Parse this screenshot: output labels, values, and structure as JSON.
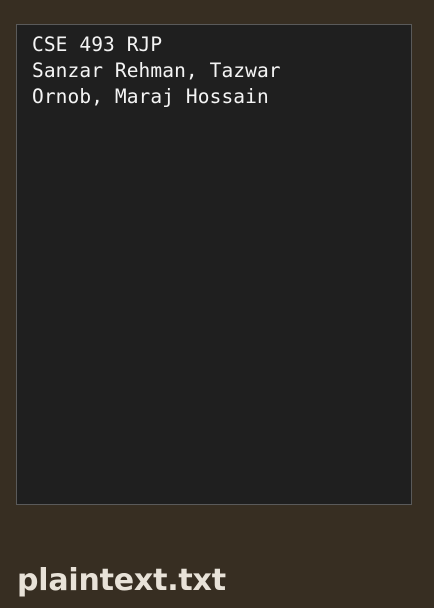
{
  "file_preview": {
    "text": "CSE 493 RJP\nSanzar Rehman, Tazwar\nOrnob, Maraj Hossain"
  },
  "file_name": "plaintext.txt",
  "colors": {
    "background": "#372e22",
    "preview_background": "#1f1f1f",
    "preview_border": "#5a5a5a",
    "preview_text": "#f4f4f4",
    "filename_text": "#e8e2d8"
  }
}
